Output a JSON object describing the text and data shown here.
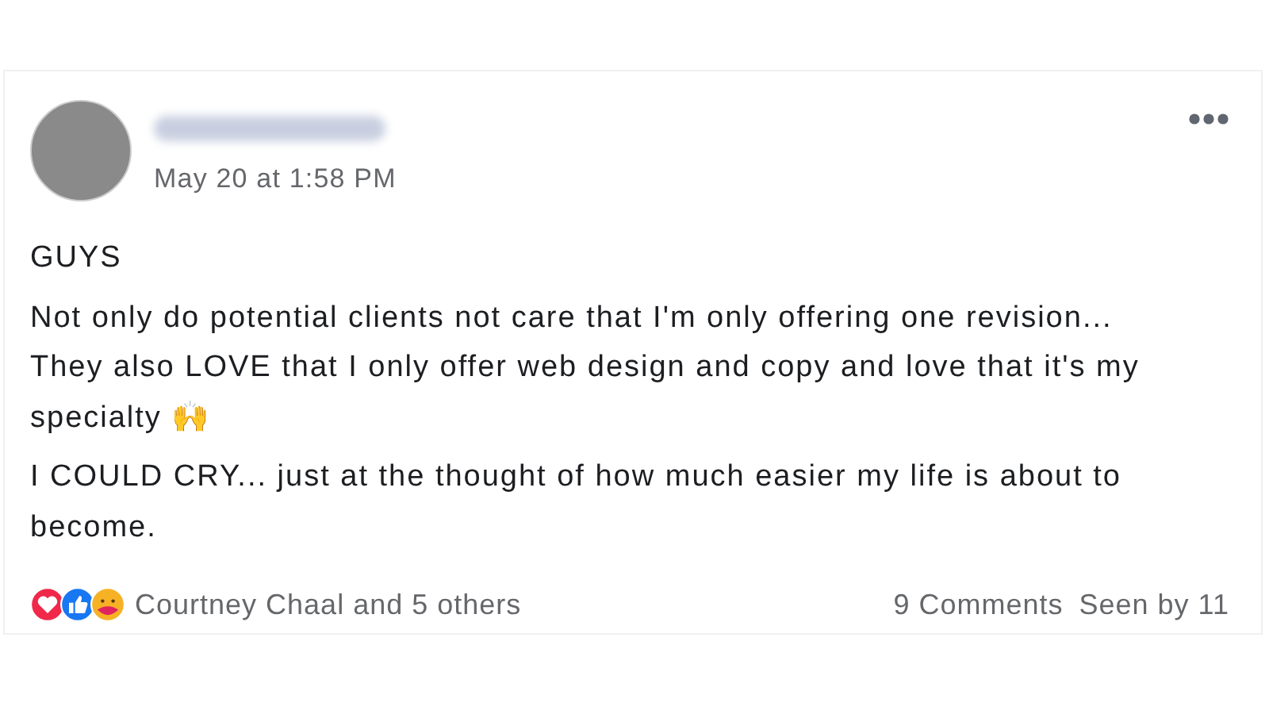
{
  "post": {
    "timestamp": "May 20 at 1:58 PM",
    "paragraphs": [
      "GUYS",
      "Not only do potential clients not care that I'm only offering one revision... They also LOVE that I only offer web design and copy and love that it's my specialty 🙌",
      "I COULD CRY... just at the thought of how much easier my life is about to become."
    ],
    "reactions": [
      {
        "kind": "love"
      },
      {
        "kind": "like"
      },
      {
        "kind": "care"
      }
    ],
    "reactors": "Courtney Chaal and 5 others",
    "comments": "9 Comments",
    "seen": "Seen by 11"
  }
}
